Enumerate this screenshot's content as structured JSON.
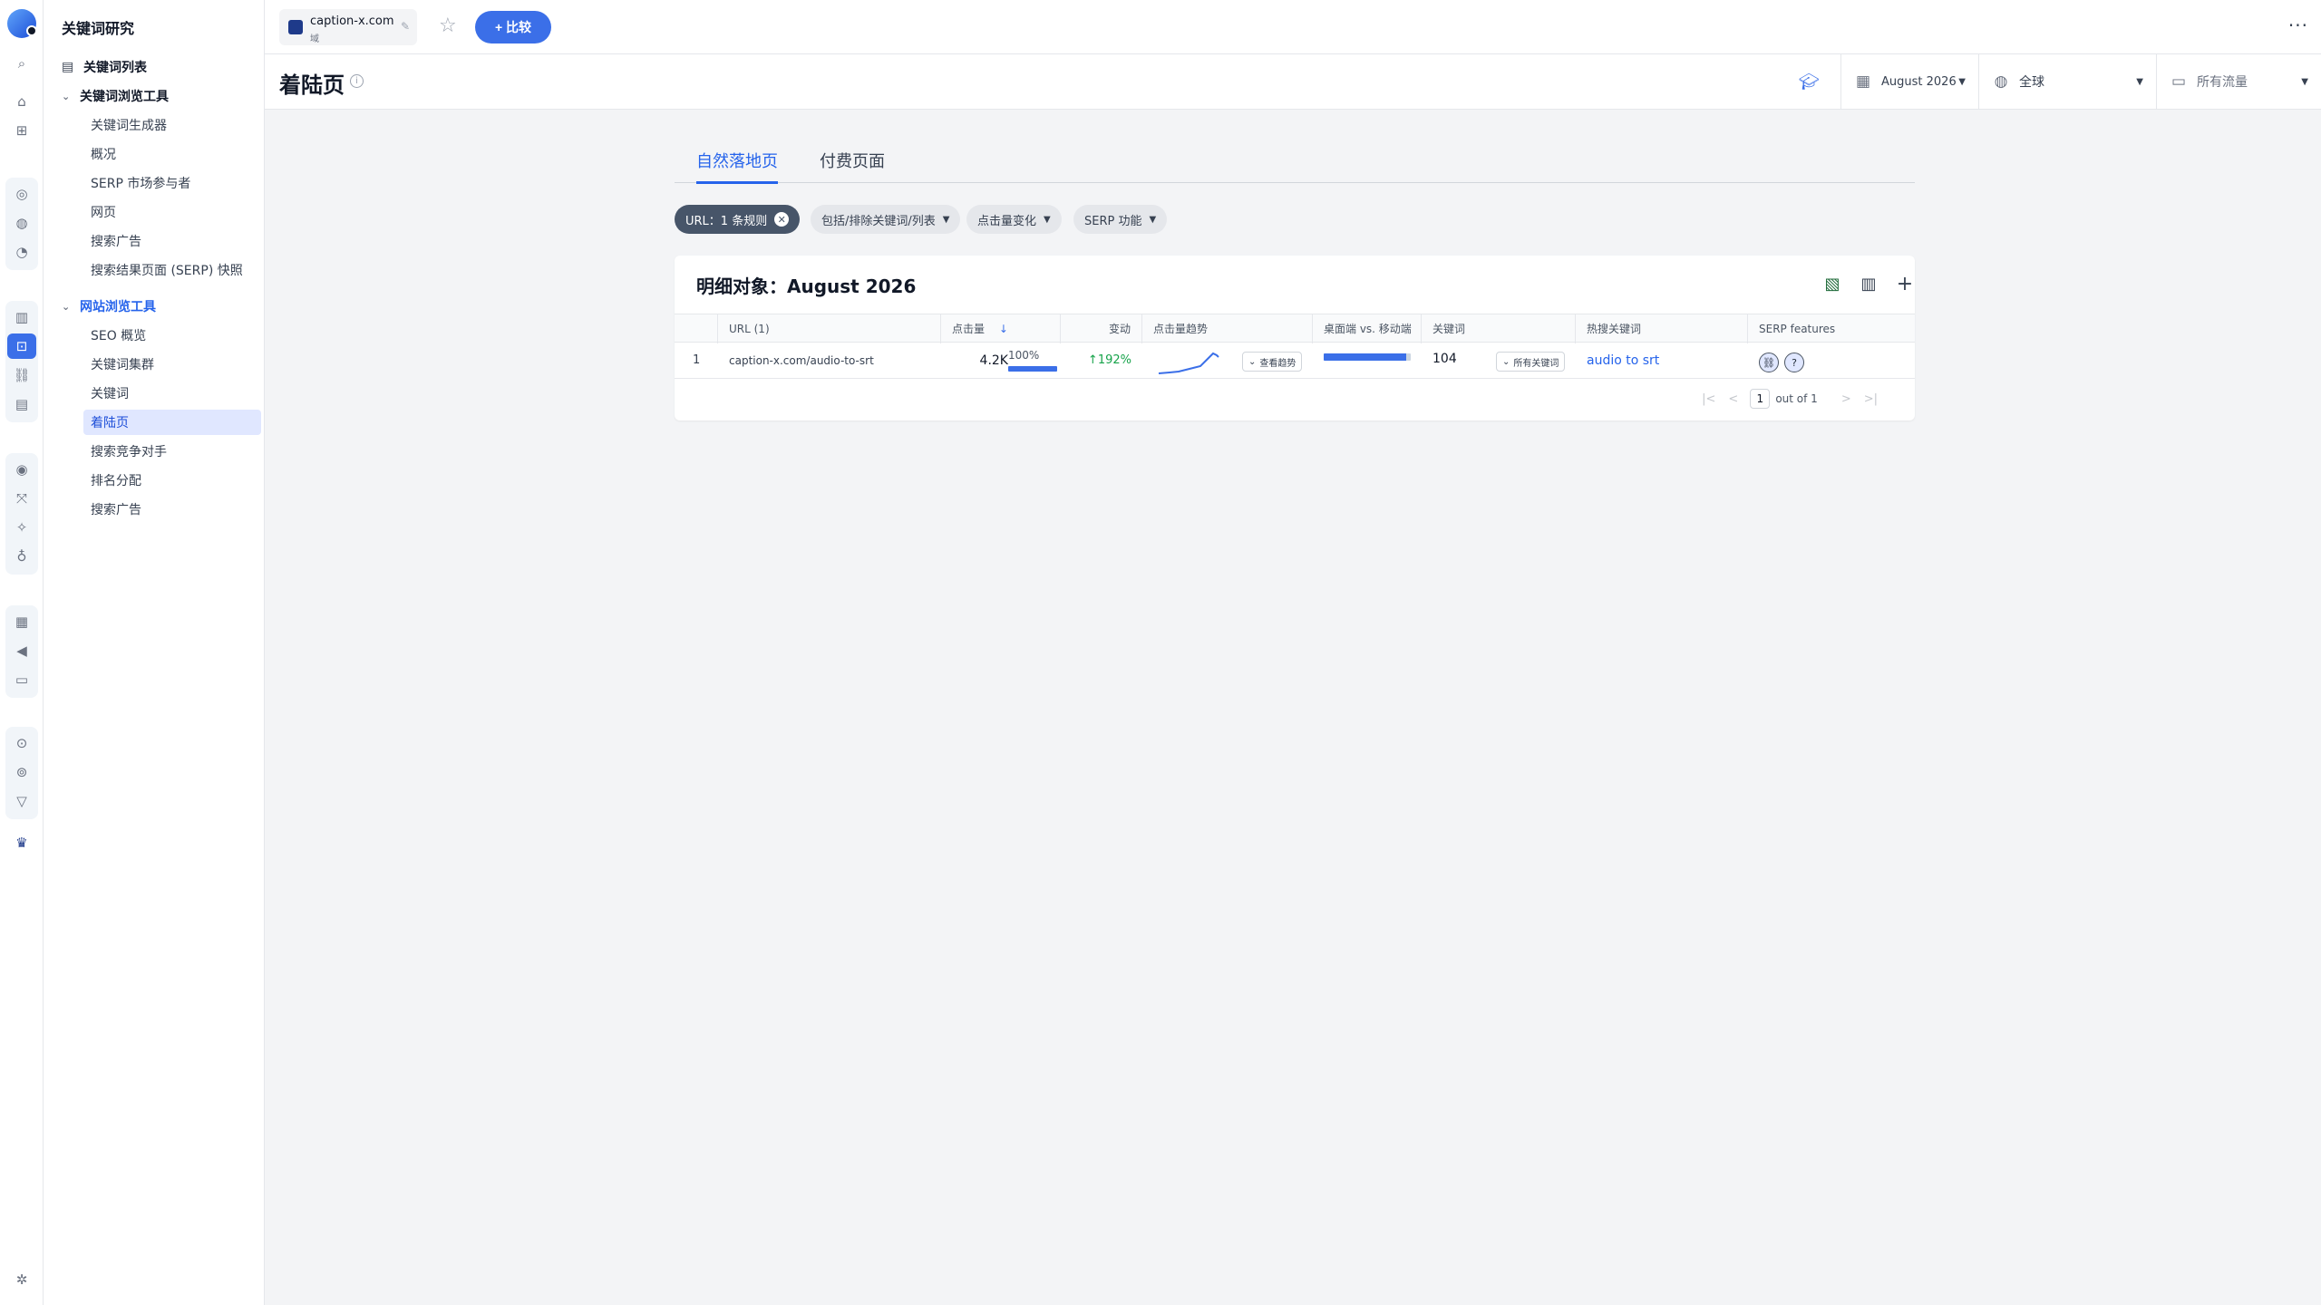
{
  "sidebar": {
    "title": "关键词研究",
    "items": [
      {
        "label": "关键词列表"
      },
      {
        "label": "关键词浏览工具"
      },
      {
        "label": "关键词生成器"
      },
      {
        "label": "概况"
      },
      {
        "label": "SERP 市场参与者"
      },
      {
        "label": "网页"
      },
      {
        "label": "搜索广告"
      },
      {
        "label": "搜索结果页面 (SERP) 快照"
      },
      {
        "label": "网站浏览工具"
      },
      {
        "label": "SEO 概览"
      },
      {
        "label": "关键词集群"
      },
      {
        "label": "关键词"
      },
      {
        "label": "着陆页"
      },
      {
        "label": "搜索竞争对手"
      },
      {
        "label": "排名分配"
      },
      {
        "label": "搜索广告"
      }
    ]
  },
  "topbar": {
    "domain": "caption-x.com",
    "domain_type": "域",
    "compare_label": "+ 比较",
    "more": "···"
  },
  "header": {
    "title": "着陆页",
    "info": "i",
    "date": "August 2026",
    "region": "全球",
    "traffic": "所有流量"
  },
  "tabs": [
    {
      "label": "自然落地页"
    },
    {
      "label": "付费页面"
    }
  ],
  "filters": {
    "url_rule": "URL：1 条规则",
    "include_exclude": "包括/排除关键词/列表",
    "clicks_change": "点击量变化",
    "serp_features": "SERP 功能"
  },
  "table": {
    "title": "明细对象：August 2026",
    "columns": [
      "URL (1)",
      "点击量",
      "变动",
      "点击量趋势",
      "桌面端 vs. 移动端",
      "关键词",
      "热搜关键词",
      "SERP features"
    ],
    "rows": [
      {
        "index": "1",
        "url": "caption-x.com/audio-to-srt",
        "clicks": "4.2K",
        "clicks_share": "100%",
        "clicks_share_value": 100,
        "change": "192%",
        "trend_label": "查看趋势",
        "desktop_share": 0.95,
        "keywords": "104",
        "all_keywords_label": "所有关键词",
        "top_keyword": "audio to srt"
      }
    ],
    "pager": {
      "page": "1",
      "of": "out of 1"
    }
  },
  "colors": {
    "accent": "#3b6fe8",
    "link": "#2563eb",
    "positive": "#16a34a"
  }
}
